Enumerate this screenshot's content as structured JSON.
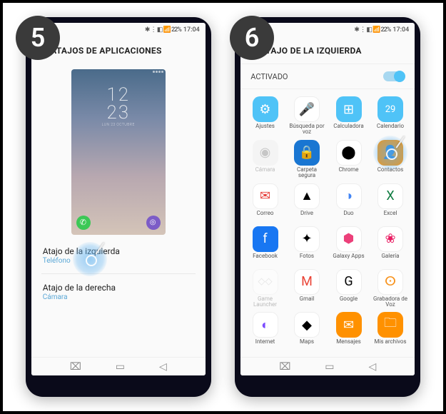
{
  "steps": {
    "five": "5",
    "six": "6"
  },
  "statusbar": {
    "icons": "✱ ⋮ ◧ 📶 22%",
    "time": "17:04"
  },
  "screen5": {
    "title": "ATAJOS DE APLICACIONES",
    "clock_time": "12\n23",
    "clock_date": "LUN 23 OCTUBRE",
    "options": [
      {
        "title": "Atajo de la izquierda",
        "sub": "Teléfono"
      },
      {
        "title": "Atajo de la derecha",
        "sub": "Cámara"
      }
    ]
  },
  "screen6": {
    "title": "ATAJO DE LA IZQUIERDA",
    "activated": "ACTIVADO",
    "apps": [
      {
        "name": "Ajustes",
        "icon": "⚙",
        "cls": "ic-ajustes"
      },
      {
        "name": "Búsqueda por voz",
        "icon": "🎤",
        "cls": "ic-voz"
      },
      {
        "name": "Calculadora",
        "icon": "⊞",
        "cls": "ic-calc"
      },
      {
        "name": "Calendario",
        "icon": "29",
        "cls": "ic-cal"
      },
      {
        "name": "Cámara",
        "icon": "◉",
        "cls": "ic-cam",
        "disabled": true
      },
      {
        "name": "Carpeta segura",
        "icon": "🔒",
        "cls": "ic-carpeta"
      },
      {
        "name": "Chrome",
        "icon": "⬤",
        "cls": "ic-chrome"
      },
      {
        "name": "Contactos",
        "icon": "👤",
        "cls": "ic-contactos",
        "highlight": true
      },
      {
        "name": "Correo",
        "icon": "✉",
        "cls": "ic-correo"
      },
      {
        "name": "Drive",
        "icon": "▲",
        "cls": "ic-drive"
      },
      {
        "name": "Duo",
        "icon": "◑",
        "cls": "ic-duo"
      },
      {
        "name": "Excel",
        "icon": "X",
        "cls": "ic-excel"
      },
      {
        "name": "Facebook",
        "icon": "f",
        "cls": "ic-fb"
      },
      {
        "name": "Fotos",
        "icon": "✦",
        "cls": "ic-fotos"
      },
      {
        "name": "Galaxy Apps",
        "icon": "⬢",
        "cls": "ic-gapps"
      },
      {
        "name": "Galería",
        "icon": "❀",
        "cls": "ic-gal"
      },
      {
        "name": "Game Launcher",
        "icon": "◇◇",
        "cls": "ic-game",
        "disabled": true
      },
      {
        "name": "Gmail",
        "icon": "M",
        "cls": "ic-gmail"
      },
      {
        "name": "Google",
        "icon": "G",
        "cls": "ic-google"
      },
      {
        "name": "Grabadora de Voz",
        "icon": "ⵙ",
        "cls": "ic-voz2"
      },
      {
        "name": "Internet",
        "icon": "◐",
        "cls": "ic-internet"
      },
      {
        "name": "Maps",
        "icon": "◆",
        "cls": "ic-maps"
      },
      {
        "name": "Mensajes",
        "icon": "✉",
        "cls": "ic-msg"
      },
      {
        "name": "Mis archivos",
        "icon": "🗀",
        "cls": "ic-files"
      }
    ]
  },
  "nav": {
    "recent": "⌧",
    "home": "▭",
    "back": "◁"
  }
}
